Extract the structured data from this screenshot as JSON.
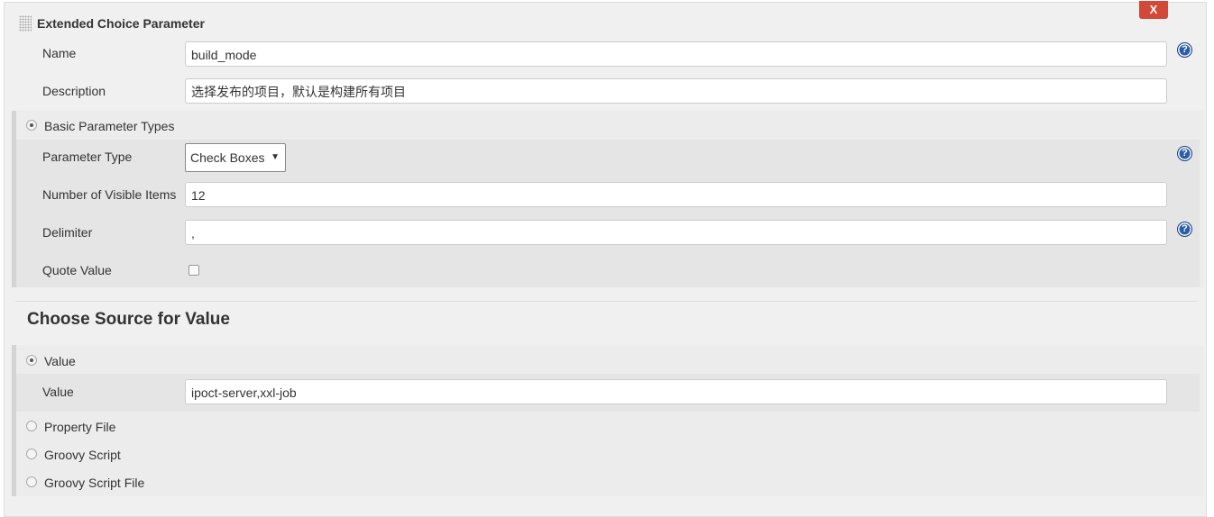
{
  "header": {
    "title": "Extended Choice Parameter",
    "close_label": "X"
  },
  "fields": {
    "name": {
      "label": "Name",
      "value": "build_mode"
    },
    "description": {
      "label": "Description",
      "value": "选择发布的项目，默认是构建所有项目"
    }
  },
  "basic": {
    "radio_label": "Basic Parameter Types",
    "parameter_type": {
      "label": "Parameter Type",
      "value": "Check Boxes"
    },
    "visible_items": {
      "label": "Number of Visible Items",
      "value": "12"
    },
    "delimiter": {
      "label": "Delimiter",
      "value": ","
    },
    "quote_value": {
      "label": "Quote Value",
      "checked": false
    }
  },
  "source": {
    "heading": "Choose Source for Value",
    "value_radio": "Value",
    "value_field": {
      "label": "Value",
      "value": "ipoct-server,xxl-job"
    },
    "property_file": "Property File",
    "groovy_script": "Groovy Script",
    "groovy_script_file": "Groovy Script File"
  },
  "help_icon": "?",
  "colors": {
    "close": "#d24939",
    "help": "#2a5ea8"
  }
}
